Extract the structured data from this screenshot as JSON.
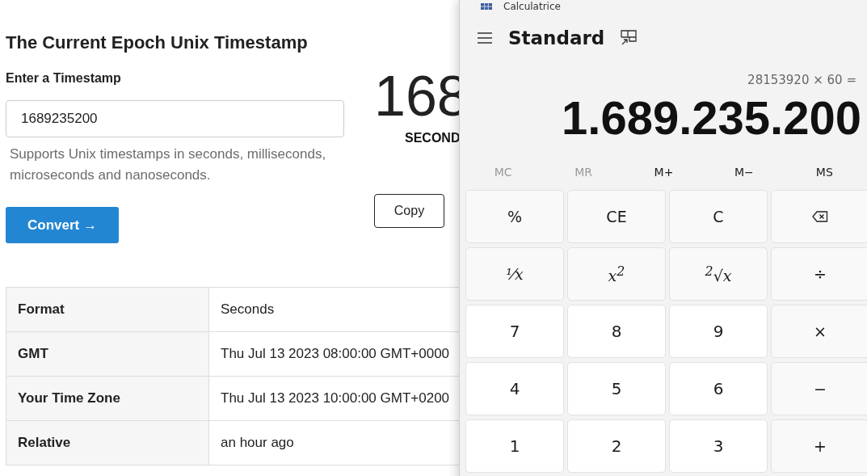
{
  "page": {
    "title": "The Current Epoch Unix Timestamp",
    "input_label": "Enter a Timestamp",
    "input_value": "1689235200",
    "help": "Supports Unix timestamps in seconds, milliseconds, microseconds and nanoseconds.",
    "convert_button": "Convert →",
    "big_number": "168",
    "unit": "SECOND",
    "copy_button": "Copy"
  },
  "table": {
    "rows": [
      {
        "label": "Format",
        "value": "Seconds"
      },
      {
        "label": "GMT",
        "value": "Thu Jul 13 2023 08:00:00 GMT+0000"
      },
      {
        "label": "Your Time Zone",
        "value": "Thu Jul 13 2023 10:00:00 GMT+0200"
      },
      {
        "label": "Relative",
        "value": "an hour ago"
      }
    ]
  },
  "calculator": {
    "title": "Calculatrice",
    "mode": "Standard",
    "expression": "28153920 × 60 =",
    "display": "1.689.235.200",
    "memory": [
      {
        "label": "MC",
        "disabled": true
      },
      {
        "label": "MR",
        "disabled": true
      },
      {
        "label": "M+",
        "disabled": false
      },
      {
        "label": "M−",
        "disabled": false
      },
      {
        "label": "MS",
        "disabled": false
      }
    ],
    "keys": [
      {
        "label": "%",
        "kind": "function"
      },
      {
        "label": "CE",
        "kind": "function"
      },
      {
        "label": "C",
        "kind": "function"
      },
      {
        "kind": "backspace"
      },
      {
        "label": "¹⁄x",
        "kind": "math"
      },
      {
        "label": "x$^{2}$",
        "kind": "math"
      },
      {
        "label": "$^{2}$√x",
        "kind": "math"
      },
      {
        "label": "÷",
        "kind": "function"
      },
      {
        "label": "7",
        "kind": "number"
      },
      {
        "label": "8",
        "kind": "number"
      },
      {
        "label": "9",
        "kind": "number"
      },
      {
        "label": "×",
        "kind": "function"
      },
      {
        "label": "4",
        "kind": "number"
      },
      {
        "label": "5",
        "kind": "number"
      },
      {
        "label": "6",
        "kind": "number"
      },
      {
        "label": "−",
        "kind": "function"
      },
      {
        "label": "1",
        "kind": "number"
      },
      {
        "label": "2",
        "kind": "number"
      },
      {
        "label": "3",
        "kind": "number"
      },
      {
        "label": "+",
        "kind": "function"
      }
    ]
  }
}
